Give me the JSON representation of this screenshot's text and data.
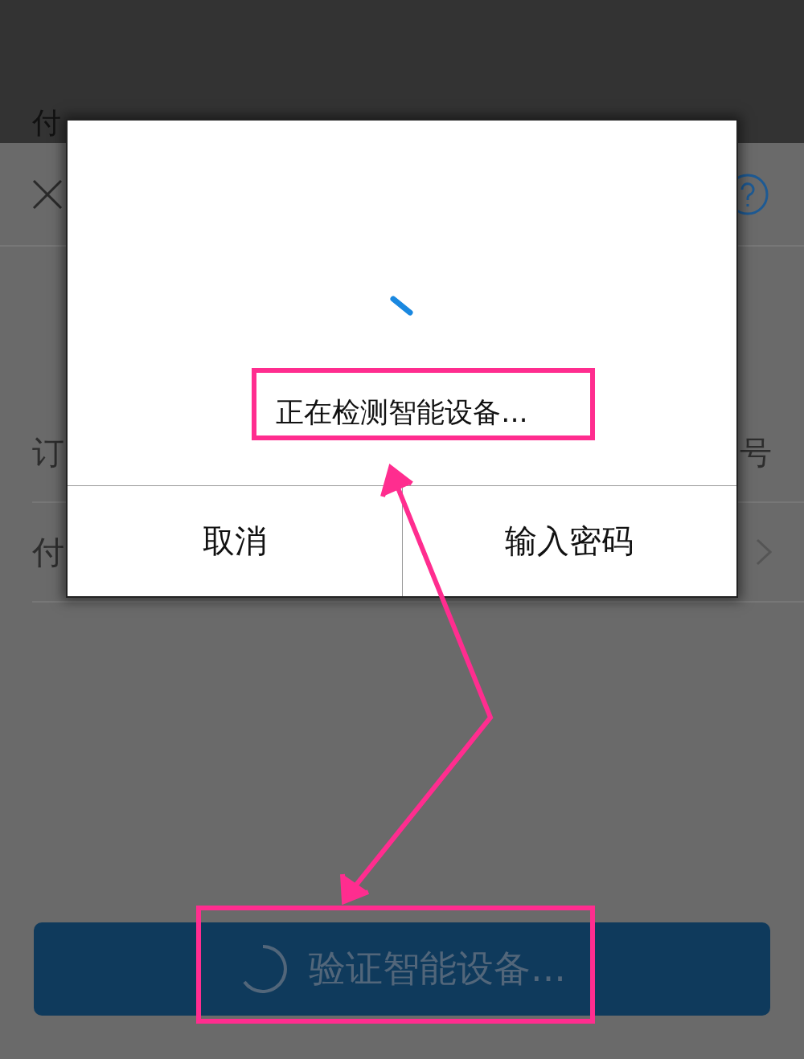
{
  "header": {
    "title": "付"
  },
  "rows": [
    {
      "kind": "value",
      "label": "订",
      "value": "号"
    },
    {
      "kind": "link",
      "label": "付"
    }
  ],
  "primary_button": {
    "label": "验证智能设备...",
    "loading": true
  },
  "dialog": {
    "message": "正在检测智能设备...",
    "loading": true,
    "buttons": [
      "取消",
      "输入密码"
    ]
  }
}
